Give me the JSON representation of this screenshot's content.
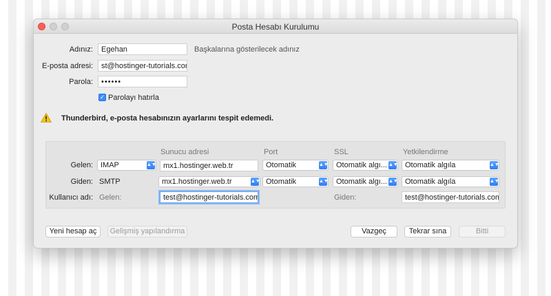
{
  "window": {
    "title": "Posta Hesabı Kurulumu"
  },
  "form": {
    "name_label": "Adınız:",
    "name_value": "Egehan",
    "name_hint": "Başkalarına gösterilecek adınız",
    "email_label": "E-posta adresi:",
    "email_value": "st@hostinger-tutorials.com",
    "password_label": "Parola:",
    "password_value": "••••••",
    "remember_label": "Parolayı hatırla",
    "remember_checked": true
  },
  "warning": {
    "icon": "warning-icon",
    "text": "Thunderbird, e-posta hesabınızın ayarlarını tespit edemedi."
  },
  "server_panel": {
    "headers": {
      "server": "Sunucu adresi",
      "port": "Port",
      "ssl": "SSL",
      "auth": "Yetkilendirme"
    },
    "incoming": {
      "label": "Gelen:",
      "protocol": "IMAP",
      "server": "mx1.hostinger.web.tr",
      "port": "Otomatik",
      "ssl": "Otomatik algı...",
      "auth": "Otomatik algıla"
    },
    "outgoing": {
      "label": "Giden:",
      "protocol": "SMTP",
      "server": "mx1.hostinger.web.tr",
      "port": "Otomatik",
      "ssl": "Otomatik algı...",
      "auth": "Otomatik algıla"
    },
    "username": {
      "label": "Kullanıcı adı:",
      "incoming_label": "Gelen:",
      "incoming_value": "test@hostinger-tutorials.com",
      "outgoing_label": "Giden:",
      "outgoing_value": "test@hostinger-tutorials.com"
    }
  },
  "buttons": {
    "new_account": "Yeni hesap aç",
    "advanced": "Gelişmiş yapılandırma",
    "cancel": "Vazgeç",
    "retry": "Tekrar sına",
    "done": "Bitti"
  },
  "colors": {
    "accent": "#3a8ef7",
    "warning": "#f5c518",
    "close": "#fc5f57"
  }
}
